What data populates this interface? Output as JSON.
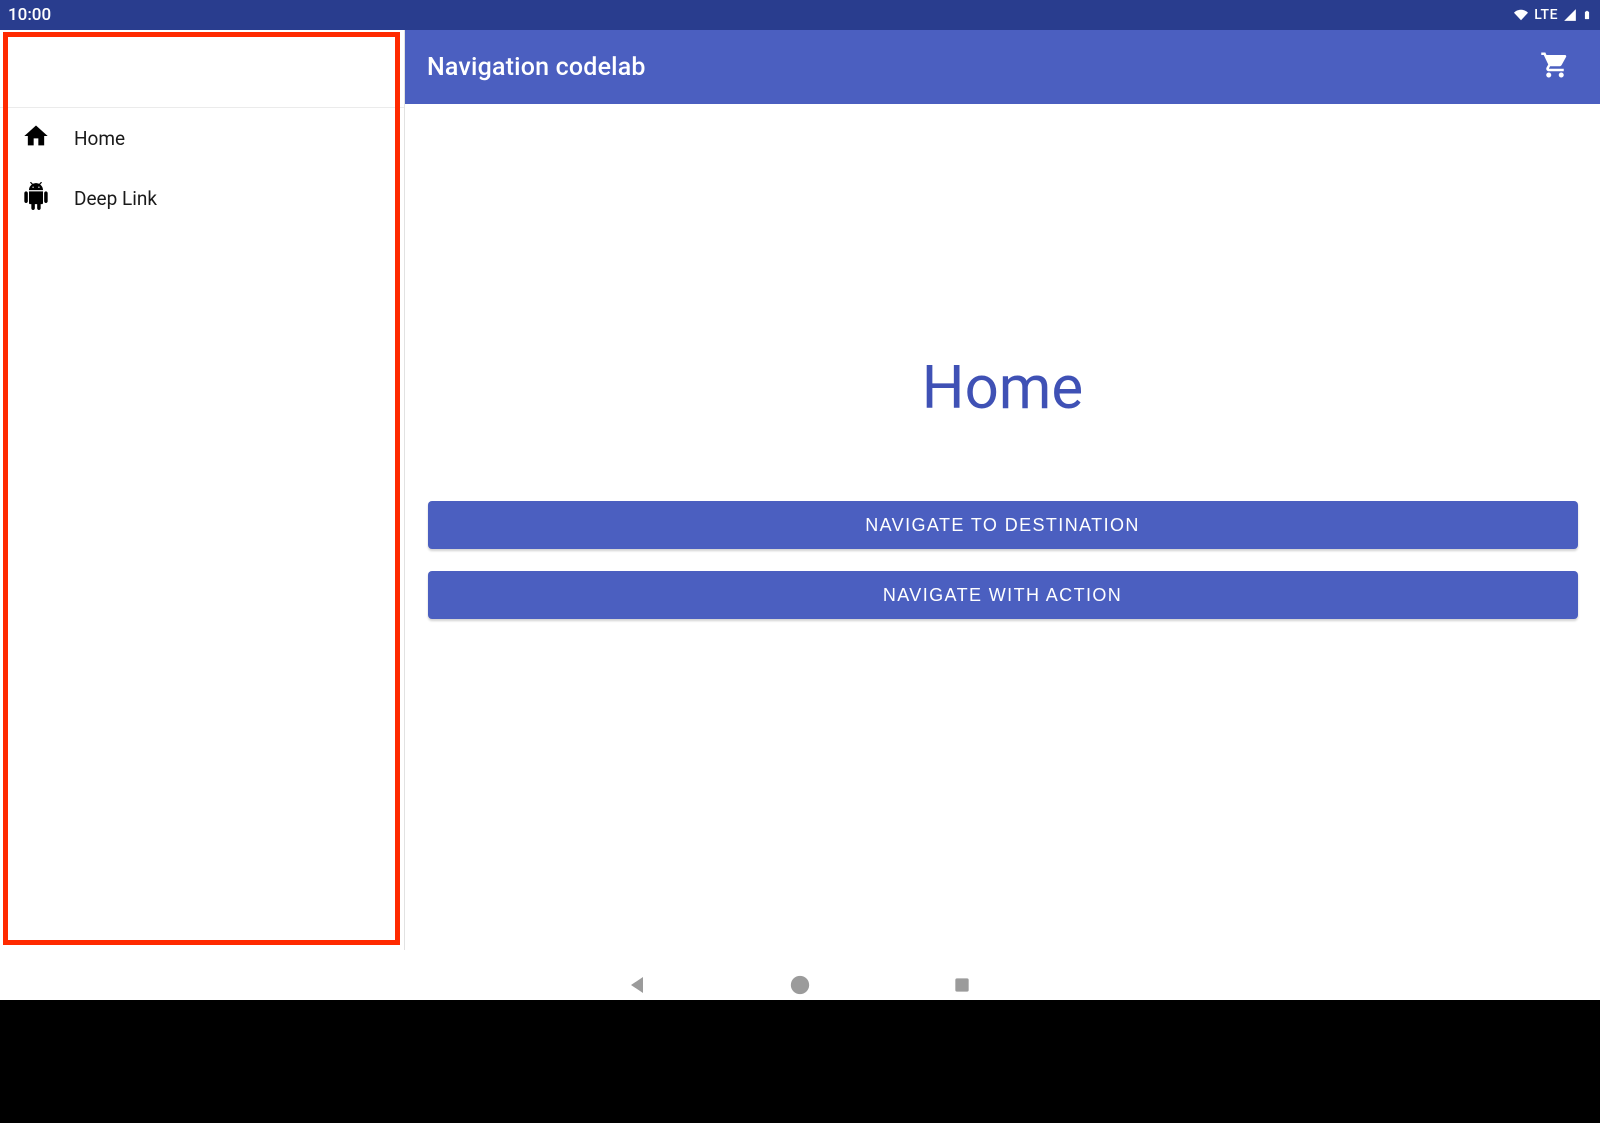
{
  "status_bar": {
    "time": "10:00",
    "network_label": "LTE"
  },
  "app_bar": {
    "title": "Navigation codelab",
    "action_icon": "shopping-cart-icon"
  },
  "drawer": {
    "items": [
      {
        "icon": "home-icon",
        "label": "Home"
      },
      {
        "icon": "android-icon",
        "label": "Deep Link"
      }
    ]
  },
  "content": {
    "title": "Home",
    "buttons": {
      "navigate_destination": "NAVIGATE TO DESTINATION",
      "navigate_action": "NAVIGATE WITH ACTION"
    }
  },
  "system_nav": {
    "back": "back-icon",
    "home": "circle-icon",
    "recent": "square-icon"
  },
  "colors": {
    "primary": "#4b5fc0",
    "primary_dark": "#293d8e",
    "accent_text": "#3f51b5",
    "highlight": "#ff2a00"
  }
}
